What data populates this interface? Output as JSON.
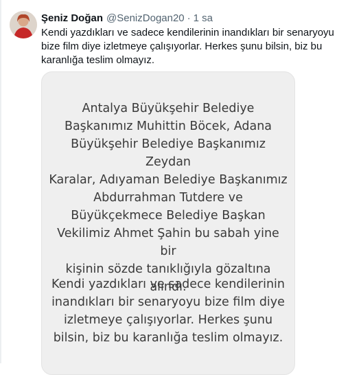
{
  "tweet": {
    "author_name": "Şeniz Doğan",
    "handle": "@SenizDogan20",
    "separator": "·",
    "time": "1 sa",
    "text": "Kendi yazdıkları ve sadece kendilerinin inandıkları bir senaryoyu bize film diye izletmeye çalışıyorlar. Herkes şunu bilsin, biz bu karanlığa teslim olmayız."
  },
  "media": {
    "paragraph_1": "Antalya Büyükşehir Belediye\nBaşkanımız Muhittin Böcek, Adana\nBüyükşehir Belediye Başkanımız Zeydan\nKaralar, Adıyaman Belediye Başkanımız\nAbdurrahman Tutdere ve\nBüyükçekmece Belediye Başkan\nVekilimiz Ahmet Şahin bu sabah yine bir\nkişinin sözde tanıklığıyla gözaltına\nalındı.",
    "paragraph_2": "Kendi yazdıkları ve sadece kendilerinin\ninandıkları bir senaryoyu bize film diye\nizletmeye çalışıyorlar. Herkes şunu\nbilsin, biz bu karanlığa teslim olmayız."
  }
}
